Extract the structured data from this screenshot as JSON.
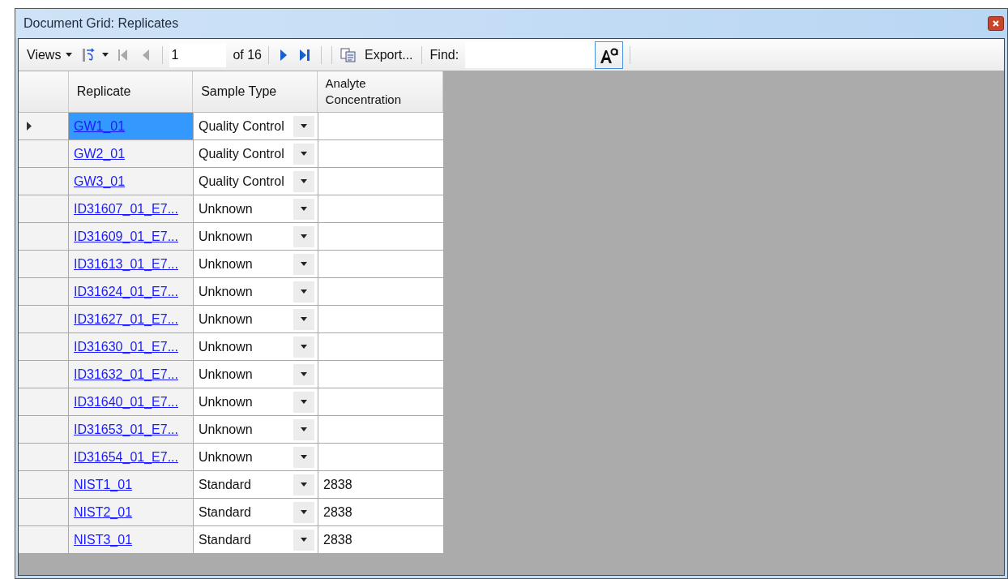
{
  "window": {
    "title": "Document Grid: Replicates"
  },
  "toolbar": {
    "views": "Views",
    "page": "1",
    "page_count": "of 16",
    "export": "Export...",
    "find_label": "Find:"
  },
  "table": {
    "columns": [
      "Replicate",
      "Sample Type",
      "Analyte Concentration"
    ],
    "rows": [
      {
        "replicate": "GW1_01",
        "sample_type": "Quality Control",
        "selected": true
      },
      {
        "replicate": "GW2_01",
        "sample_type": "Quality Control",
        "selected": false
      },
      {
        "replicate": "GW3_01",
        "sample_type": "Quality Control",
        "selected": false
      },
      {
        "replicate": "ID31607_01_E7...",
        "sample_type": "Unknown",
        "selected": false
      },
      {
        "replicate": "ID31609_01_E7...",
        "sample_type": "Unknown",
        "selected": false
      },
      {
        "replicate": "ID31613_01_E7...",
        "sample_type": "Unknown",
        "selected": false
      },
      {
        "replicate": "ID31624_01_E7...",
        "sample_type": "Unknown",
        "selected": false
      },
      {
        "replicate": "ID31627_01_E7...",
        "sample_type": "Unknown",
        "selected": false
      },
      {
        "replicate": "ID31630_01_E7...",
        "sample_type": "Unknown",
        "selected": false
      },
      {
        "replicate": "ID31632_01_E7...",
        "sample_type": "Unknown",
        "selected": false
      },
      {
        "replicate": "ID31640_01_E7...",
        "sample_type": "Unknown",
        "selected": false
      },
      {
        "replicate": "ID31653_01_E7...",
        "sample_type": "Unknown",
        "selected": false
      },
      {
        "replicate": "ID31654_01_E7...",
        "sample_type": "Unknown",
        "selected": false
      },
      {
        "replicate": "NIST1_01",
        "sample_type": "Standard",
        "concentration": "2838",
        "selected": false
      },
      {
        "replicate": "NIST2_01",
        "sample_type": "Standard",
        "concentration": "2838",
        "selected": false
      },
      {
        "replicate": "NIST3_01",
        "sample_type": "Standard",
        "concentration": "2838",
        "selected": false
      }
    ]
  }
}
